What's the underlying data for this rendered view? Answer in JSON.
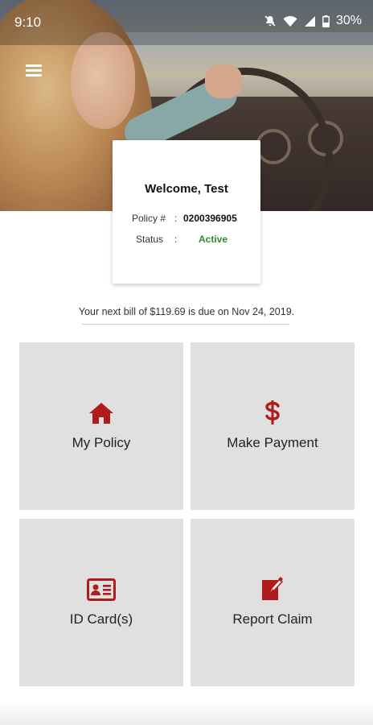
{
  "status_bar": {
    "time": "9:10",
    "battery": "30%"
  },
  "welcome": {
    "title": "Welcome, Test",
    "policy_label": "Policy #",
    "policy_number": "0200396905",
    "status_label": "Status",
    "separator": ":",
    "status_value": "Active"
  },
  "bill_notice": "Your next bill of $119.69 is due on Nov 24, 2019.",
  "tiles": [
    {
      "label": "My Policy",
      "icon": "home-icon"
    },
    {
      "label": "Make Payment",
      "icon": "dollar-icon"
    },
    {
      "label": "ID Card(s)",
      "icon": "id-card-icon"
    },
    {
      "label": "Report Claim",
      "icon": "report-claim-icon"
    }
  ],
  "colors": {
    "accent": "#b01b1b",
    "tile_bg": "#e0e0e0",
    "active": "#2e8b2e"
  }
}
